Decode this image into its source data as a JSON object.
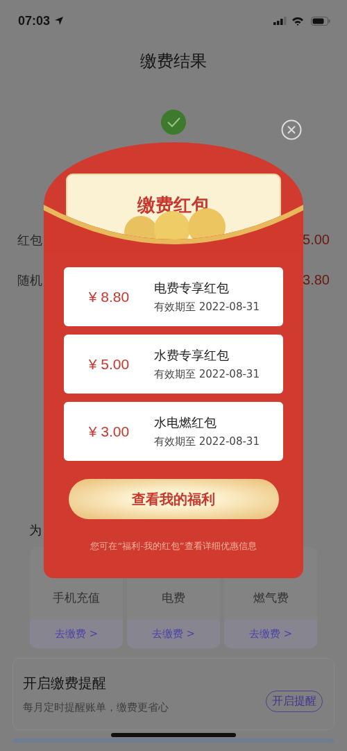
{
  "status_bar": {
    "time": "07:03"
  },
  "header": {
    "title": "缴费结果"
  },
  "result_rows": [
    {
      "label": "红包",
      "value": "5.00"
    },
    {
      "label": "随机",
      "value": "3.80"
    }
  ],
  "section_label": "为",
  "services": [
    {
      "name": "手机充值",
      "action": "去缴费 >"
    },
    {
      "name": "电费",
      "action": "去缴费 >"
    },
    {
      "name": "燃气费",
      "action": "去缴费 >"
    }
  ],
  "reminder": {
    "title": "开启缴费提醒",
    "subtitle": "每月定时提醒账单，缴费更省心",
    "button": "开启提醒"
  },
  "popup": {
    "title": "缴费红包",
    "coupons": [
      {
        "amount": "¥ 8.80",
        "name": "电费专享红包",
        "expiry": "有效期至 2022-08-31"
      },
      {
        "amount": "¥ 5.00",
        "name": "水费专享红包",
        "expiry": "有效期至 2022-08-31"
      },
      {
        "amount": "¥ 3.00",
        "name": "水电燃红包",
        "expiry": "有效期至 2022-08-31"
      }
    ],
    "button": "查看我的福利",
    "note": "您可在“福利-我的红包”查看详细优惠信息"
  }
}
